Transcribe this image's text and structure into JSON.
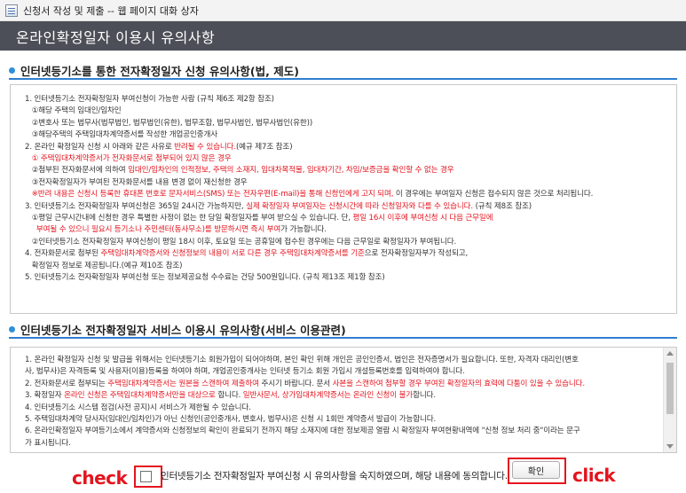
{
  "window": {
    "title": "신청서 작성 및 제출 -- 웹 페이지 대화 상자"
  },
  "header": {
    "title": "온라인확정일자 이용시 유의사항"
  },
  "section1": {
    "heading": "인터넷등기소를 통한 전자확정일자 신청 유의사항(법, 제도)",
    "lines": [
      [
        {
          "t": "1. 인터넷등기소 전자확정일자 부여신청이 가능한 사람 (규칙 제6조 제2항 참조)"
        }
      ],
      [
        {
          "t": "   ①해당 주택의 임대인/임차인"
        }
      ],
      [
        {
          "t": "   ②변호사 또는 법무사(법무법인, 법무법인(유한), 법무조합, 법무사법인, 법무사법인(유한))"
        }
      ],
      [
        {
          "t": "   ③해당주택의 주택임대차계약증서를 작성한 개업공인중개사"
        }
      ],
      [
        {
          "t": "2. 온라인 확정일자 신청 시 아래와 같은 사유로 "
        },
        {
          "t": "반려될 수 있습니다.",
          "red": true
        },
        {
          "t": "(예규 제7조 참조)"
        }
      ],
      [
        {
          "t": "   ① 주택임대차계약증서가 전자화문서로 첨부되어 있지 않은 경우",
          "red": true
        }
      ],
      [
        {
          "t": "   ②첨부된 전자화문서에 의하여 "
        },
        {
          "t": "임대인/임차인의 인적정보, 주택의 소재지, 임대차목적물, 임대차기간, 차임/보증금을 확인할 수 없는 경우",
          "red": true
        }
      ],
      [
        {
          "t": "   ③전자확정일자가 부여된 전자화문서를 내용 변경 없이 재신청한 경우"
        }
      ],
      [
        {
          "t": "   ※반려 내용은 신청시 등록한 휴대폰 번호로 문자서비스(SMS) 또는 전자우편(E-mail)을 통해 신청인에게 고지 되며, ",
          "red": true
        },
        {
          "t": "이 경우에는 부여일자 신청은 접수되지 않은 것으로 처리됩니다."
        }
      ],
      [
        {
          "t": "3. 인터넷등기소 전자확정일자 부여신청은 365일 24시간 가능하지만, "
        },
        {
          "t": "실제 확정일자 부여일자는 신청시간에 따라 신청일자와 다를 수 있습니다.",
          "red": true
        },
        {
          "t": " (규칙 제8조 참조)"
        }
      ],
      [
        {
          "t": "   ①평일 근무시간내에 신청한 경우 특별한 사정이 없는 한 당일 확정일자를 부여 받으실 수 있습니다. 단, "
        },
        {
          "t": "평일 16시 이후에 부여신청 시 다음 근무일에",
          "red": true
        }
      ],
      [
        {
          "t": "     부여될 수 있으니 필요시 등기소나 주민센터(동사무소)를 방문하시면 즉시 부여",
          "red": true
        },
        {
          "t": "가 가능합니다."
        }
      ],
      [
        {
          "t": "   ②인터넷등기소 전자확정일자 부여신청이 평일 18시 이후, 토요일 또는 공휴일에 접수된 경우에는 다음 근무일로 확정일자가 부여됩니다."
        }
      ],
      [
        {
          "t": "4. 전자화문서로 첨부된 "
        },
        {
          "t": "주택임대차계약증서와 신청정보의 내용이 서로 다른 경우 주택임대차계약증서를 기준",
          "red": true
        },
        {
          "t": "으로 전자확정일자부가 작성되고,"
        }
      ],
      [
        {
          "t": "   확정일자 정보로 제공됩니다.(예규 제10조 참조)"
        }
      ],
      [
        {
          "t": "5. 인터넷등기소 전자확정일자 부여신청 또는 정보제공요청 수수료는 건당 500원입니다. (규칙 제13조 제1항 참조)"
        }
      ]
    ]
  },
  "section2": {
    "heading": "인터넷등기소 전자확정일자 서비스 이용시 유의사항(서비스 이용관련)",
    "lines": [
      [
        {
          "t": "1. 온라인 확정일자 신청 및 발급을 위해서는 인터넷등기소 회원가입이 되어야하며, 본인 확인 위해 개인은 공인인증서, 법인은 전자증명서가 필요합니다. 또한, 자격자 대리인(변호"
        }
      ],
      [
        {
          "t": "사, 법무사)은 자격등록 및 사용자(이용)등록을 하여야 하며, 개업공인중개사는 인터넷 등기소 회원 가입시 개설등록번호를 입력하여야 합니다."
        }
      ],
      [
        {
          "t": "2. 전자화문서로 첨부되는 "
        },
        {
          "t": "주택임대차계약증서는 원본을 스캔하여 제출하여",
          "red": true
        },
        {
          "t": " 주시기 바랍니다. 문서 "
        },
        {
          "t": "사본을 스캔하여 첨부할 경우 부여된 확정일자의 효력에 다툼이 있을 수 있습니다.",
          "red": true
        }
      ],
      [
        {
          "t": "3. 확정일자 "
        },
        {
          "t": "온라인 신청은 주택임대차계약증서만을 대상으로",
          "red": true
        },
        {
          "t": " 합니다. "
        },
        {
          "t": "일반사문서, 상가임대차계약증서는 온라인 신청이 불가",
          "red": true
        },
        {
          "t": "합니다."
        }
      ],
      [
        {
          "t": "4. 인터넷등기소 시스템 점검(사전 공지)시 서비스가 제한될 수 있습니다."
        }
      ],
      [
        {
          "t": "5. 주택임대차계약 당사자(임대인/임차인)가 아닌 신청인(공인중개사, 변호사, 법무사)은 신청 시 1회만 계약증서 발급이 가능합니다."
        }
      ],
      [
        {
          "t": "6. 온라인확정일자 부여등기소에서 계약증서와 신청정보의 확인이 완료되기 전까지 해당 소재지에 대한 정보제공 열람 시 확정일자 부여현황내역에 \"신청 정보 처리 중\"이라는 문구"
        }
      ],
      [
        {
          "t": "가 표시됩니다."
        }
      ]
    ]
  },
  "footer": {
    "check_note": "check",
    "agree_text": "인터넷등기소 전자확정일자 부여신청 시 유의사항을 숙지하였으며, 해당 내용에 동의합니다.",
    "confirm_label": "확인",
    "click_note": "click"
  },
  "colors": {
    "header_bg": "#4c4f57",
    "accent_blue": "#2f7fcf",
    "warning_red": "#e4141e"
  }
}
